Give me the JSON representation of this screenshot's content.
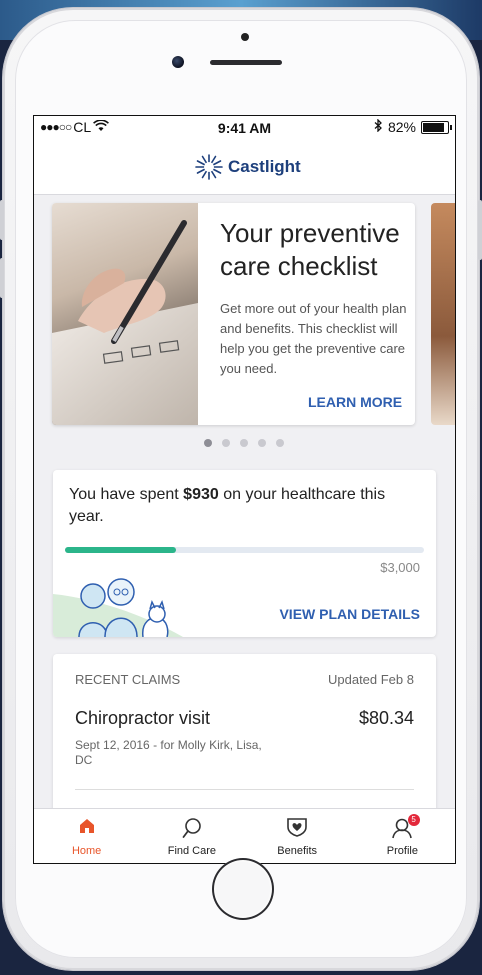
{
  "status_bar": {
    "carrier": "CL",
    "signal": "●●●○○",
    "time": "9:41 AM",
    "battery_text": "82%",
    "battery_level": 0.82
  },
  "app_bar": {
    "logo_text": "Castlight"
  },
  "carousel": {
    "hero": {
      "title": "Your preventive care checklist",
      "body": "Get more out of your health plan and benefits. This checklist will help you get the preventive care you need.",
      "cta": "LEARN MORE"
    },
    "page_count": 5,
    "active_page": 0
  },
  "spend": {
    "text_before": "You have spent ",
    "amount": "$930",
    "text_after": " on your healthcare this year.",
    "limit": "$3,000",
    "progress_fraction": 0.31,
    "cta": "VIEW PLAN DETAILS"
  },
  "claims": {
    "header": "RECENT CLAIMS",
    "updated": "Updated Feb 8",
    "items": [
      {
        "title": "Chiropractor visit",
        "amount": "$80.34",
        "detail": "Sept 12, 2016 - for Molly Kirk, Lisa, DC"
      }
    ]
  },
  "tabbar": {
    "items": [
      {
        "label": "Home",
        "icon": "home-icon",
        "active": true
      },
      {
        "label": "Find Care",
        "icon": "search-icon",
        "active": false
      },
      {
        "label": "Benefits",
        "icon": "heart-shield-icon",
        "active": false
      },
      {
        "label": "Profile",
        "icon": "profile-icon",
        "active": false,
        "badge": "5"
      }
    ]
  },
  "colors": {
    "accent": "#2f5fb0",
    "active_tab": "#e8552a",
    "progress": "#2bb58a",
    "badge": "#e3283b"
  }
}
